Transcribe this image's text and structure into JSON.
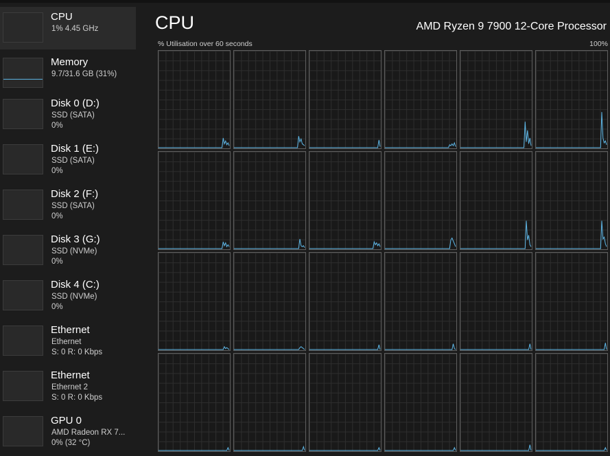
{
  "sidebar": {
    "items": [
      {
        "title": "CPU",
        "line1": "1%  4.45 GHz",
        "line2": ""
      },
      {
        "title": "Memory",
        "line1": "9.7/31.6 GB (31%)",
        "line2": ""
      },
      {
        "title": "Disk 0 (D:)",
        "line1": "SSD (SATA)",
        "line2": "0%"
      },
      {
        "title": "Disk 1 (E:)",
        "line1": "SSD (SATA)",
        "line2": "0%"
      },
      {
        "title": "Disk 2 (F:)",
        "line1": "SSD (SATA)",
        "line2": "0%"
      },
      {
        "title": "Disk 3 (G:)",
        "line1": "SSD (NVMe)",
        "line2": "0%"
      },
      {
        "title": "Disk 4 (C:)",
        "line1": "SSD (NVMe)",
        "line2": "0%"
      },
      {
        "title": "Ethernet",
        "line1": "Ethernet",
        "line2": "S: 0  R: 0 Kbps"
      },
      {
        "title": "Ethernet",
        "line1": "Ethernet 2",
        "line2": "S: 0  R: 0 Kbps"
      },
      {
        "title": "GPU 0",
        "line1": "AMD Radeon RX 7...",
        "line2": "0%  (32 °C)"
      }
    ],
    "memory_usage_fraction": 0.31
  },
  "main": {
    "title": "CPU",
    "processor": "AMD Ryzen 9 7900 12-Core Processor",
    "utilisation_label": "% Utilisation over 60 seconds",
    "max_label": "100%"
  },
  "colors": {
    "graph_line": "#5fb8e8",
    "background": "#1c1c1c",
    "selected": "#2b2b2b"
  },
  "cores": [
    [
      0,
      0,
      0,
      0,
      0,
      0,
      0,
      0,
      0,
      0,
      0,
      0,
      0,
      0,
      0,
      0,
      0,
      0,
      0,
      0,
      0,
      0,
      0,
      0,
      0,
      0,
      0,
      0,
      0,
      0,
      0,
      0,
      0,
      0,
      0,
      0,
      0,
      0,
      0,
      0,
      0,
      0,
      0,
      0,
      0,
      0,
      0,
      0,
      0,
      0,
      0,
      0,
      0,
      0,
      10,
      4,
      7,
      3,
      5,
      2
    ],
    [
      0,
      0,
      0,
      0,
      0,
      0,
      0,
      0,
      0,
      0,
      0,
      0,
      0,
      0,
      0,
      0,
      0,
      0,
      0,
      0,
      0,
      0,
      0,
      0,
      0,
      0,
      0,
      0,
      0,
      0,
      0,
      0,
      0,
      0,
      0,
      0,
      0,
      0,
      0,
      0,
      0,
      0,
      0,
      0,
      0,
      0,
      0,
      0,
      0,
      0,
      0,
      0,
      0,
      0,
      12,
      6,
      9,
      4,
      3,
      2
    ],
    [
      0,
      0,
      0,
      0,
      0,
      0,
      0,
      0,
      0,
      0,
      0,
      0,
      0,
      0,
      0,
      0,
      0,
      0,
      0,
      0,
      0,
      0,
      0,
      0,
      0,
      0,
      0,
      0,
      0,
      0,
      0,
      0,
      0,
      0,
      0,
      0,
      0,
      0,
      0,
      0,
      0,
      0,
      0,
      0,
      0,
      0,
      0,
      0,
      0,
      0,
      0,
      0,
      0,
      0,
      0,
      0,
      0,
      0,
      8,
      1
    ],
    [
      0,
      0,
      0,
      0,
      0,
      0,
      0,
      0,
      0,
      0,
      0,
      0,
      0,
      0,
      0,
      0,
      0,
      0,
      0,
      0,
      0,
      0,
      0,
      0,
      0,
      0,
      0,
      0,
      0,
      0,
      0,
      0,
      0,
      0,
      0,
      0,
      0,
      0,
      0,
      0,
      0,
      0,
      0,
      0,
      0,
      0,
      0,
      0,
      0,
      0,
      0,
      0,
      0,
      0,
      3,
      2,
      4,
      2,
      5,
      1
    ],
    [
      0,
      0,
      0,
      0,
      0,
      0,
      0,
      0,
      0,
      0,
      0,
      0,
      0,
      0,
      0,
      0,
      0,
      0,
      0,
      0,
      0,
      0,
      0,
      0,
      0,
      0,
      0,
      0,
      0,
      0,
      0,
      0,
      0,
      0,
      0,
      0,
      0,
      0,
      0,
      0,
      0,
      0,
      0,
      0,
      0,
      0,
      0,
      0,
      0,
      0,
      0,
      0,
      0,
      0,
      27,
      6,
      18,
      4,
      10,
      2
    ],
    [
      0,
      0,
      0,
      0,
      0,
      0,
      0,
      0,
      0,
      0,
      0,
      0,
      0,
      0,
      0,
      0,
      0,
      0,
      0,
      0,
      0,
      0,
      0,
      0,
      0,
      0,
      0,
      0,
      0,
      0,
      0,
      0,
      0,
      0,
      0,
      0,
      0,
      0,
      0,
      0,
      0,
      0,
      0,
      0,
      0,
      0,
      0,
      0,
      0,
      0,
      0,
      0,
      0,
      0,
      0,
      37,
      10,
      5,
      7,
      3
    ],
    [
      0,
      0,
      0,
      0,
      0,
      0,
      0,
      0,
      0,
      0,
      0,
      0,
      0,
      0,
      0,
      0,
      0,
      0,
      0,
      0,
      0,
      0,
      0,
      0,
      0,
      0,
      0,
      0,
      0,
      0,
      0,
      0,
      0,
      0,
      0,
      0,
      0,
      0,
      0,
      0,
      0,
      0,
      0,
      0,
      0,
      0,
      0,
      0,
      0,
      0,
      0,
      0,
      0,
      0,
      7,
      3,
      6,
      2,
      4,
      2
    ],
    [
      0,
      0,
      0,
      0,
      0,
      0,
      0,
      0,
      0,
      0,
      0,
      0,
      0,
      0,
      0,
      0,
      0,
      0,
      0,
      0,
      0,
      0,
      0,
      0,
      0,
      0,
      0,
      0,
      0,
      0,
      0,
      0,
      0,
      0,
      0,
      0,
      0,
      0,
      0,
      0,
      0,
      0,
      0,
      0,
      0,
      0,
      0,
      0,
      0,
      0,
      0,
      0,
      0,
      0,
      0,
      10,
      3,
      2,
      3,
      1
    ],
    [
      0,
      0,
      0,
      0,
      0,
      0,
      0,
      0,
      0,
      0,
      0,
      0,
      0,
      0,
      0,
      0,
      0,
      0,
      0,
      0,
      0,
      0,
      0,
      0,
      0,
      0,
      0,
      0,
      0,
      0,
      0,
      0,
      0,
      0,
      0,
      0,
      0,
      0,
      0,
      0,
      0,
      0,
      0,
      0,
      0,
      0,
      0,
      0,
      0,
      0,
      0,
      0,
      0,
      0,
      7,
      4,
      6,
      3,
      5,
      2
    ],
    [
      0,
      0,
      0,
      0,
      0,
      0,
      0,
      0,
      0,
      0,
      0,
      0,
      0,
      0,
      0,
      0,
      0,
      0,
      0,
      0,
      0,
      0,
      0,
      0,
      0,
      0,
      0,
      0,
      0,
      0,
      0,
      0,
      0,
      0,
      0,
      0,
      0,
      0,
      0,
      0,
      0,
      0,
      0,
      0,
      0,
      0,
      0,
      0,
      0,
      0,
      0,
      0,
      0,
      0,
      0,
      9,
      11,
      8,
      5,
      2
    ],
    [
      0,
      0,
      0,
      0,
      0,
      0,
      0,
      0,
      0,
      0,
      0,
      0,
      0,
      0,
      0,
      0,
      0,
      0,
      0,
      0,
      0,
      0,
      0,
      0,
      0,
      0,
      0,
      0,
      0,
      0,
      0,
      0,
      0,
      0,
      0,
      0,
      0,
      0,
      0,
      0,
      0,
      0,
      0,
      0,
      0,
      0,
      0,
      0,
      0,
      0,
      0,
      0,
      0,
      0,
      0,
      29,
      9,
      14,
      4,
      2
    ],
    [
      0,
      0,
      0,
      0,
      0,
      0,
      0,
      0,
      0,
      0,
      0,
      0,
      0,
      0,
      0,
      0,
      0,
      0,
      0,
      0,
      0,
      0,
      0,
      0,
      0,
      0,
      0,
      0,
      0,
      0,
      0,
      0,
      0,
      0,
      0,
      0,
      0,
      0,
      0,
      0,
      0,
      0,
      0,
      0,
      0,
      0,
      0,
      0,
      0,
      0,
      0,
      0,
      0,
      0,
      0,
      29,
      10,
      12,
      5,
      2
    ],
    [
      0,
      0,
      0,
      0,
      0,
      0,
      0,
      0,
      0,
      0,
      0,
      0,
      0,
      0,
      0,
      0,
      0,
      0,
      0,
      0,
      0,
      0,
      0,
      0,
      0,
      0,
      0,
      0,
      0,
      0,
      0,
      0,
      0,
      0,
      0,
      0,
      0,
      0,
      0,
      0,
      0,
      0,
      0,
      0,
      0,
      0,
      0,
      0,
      0,
      0,
      0,
      0,
      0,
      0,
      0,
      3,
      1,
      2,
      1,
      0
    ],
    [
      0,
      0,
      0,
      0,
      0,
      0,
      0,
      0,
      0,
      0,
      0,
      0,
      0,
      0,
      0,
      0,
      0,
      0,
      0,
      0,
      0,
      0,
      0,
      0,
      0,
      0,
      0,
      0,
      0,
      0,
      0,
      0,
      0,
      0,
      0,
      0,
      0,
      0,
      0,
      0,
      0,
      0,
      0,
      0,
      0,
      0,
      0,
      0,
      0,
      0,
      0,
      0,
      0,
      0,
      0,
      2,
      3,
      2,
      1,
      0
    ],
    [
      0,
      0,
      0,
      0,
      0,
      0,
      0,
      0,
      0,
      0,
      0,
      0,
      0,
      0,
      0,
      0,
      0,
      0,
      0,
      0,
      0,
      0,
      0,
      0,
      0,
      0,
      0,
      0,
      0,
      0,
      0,
      0,
      0,
      0,
      0,
      0,
      0,
      0,
      0,
      0,
      0,
      0,
      0,
      0,
      0,
      0,
      0,
      0,
      0,
      0,
      0,
      0,
      0,
      0,
      0,
      0,
      0,
      0,
      5,
      0
    ],
    [
      0,
      0,
      0,
      0,
      0,
      0,
      0,
      0,
      0,
      0,
      0,
      0,
      0,
      0,
      0,
      0,
      0,
      0,
      0,
      0,
      0,
      0,
      0,
      0,
      0,
      0,
      0,
      0,
      0,
      0,
      0,
      0,
      0,
      0,
      0,
      0,
      0,
      0,
      0,
      0,
      0,
      0,
      0,
      0,
      0,
      0,
      0,
      0,
      0,
      0,
      0,
      0,
      0,
      0,
      0,
      0,
      0,
      6,
      1,
      0
    ],
    [
      0,
      0,
      0,
      0,
      0,
      0,
      0,
      0,
      0,
      0,
      0,
      0,
      0,
      0,
      0,
      0,
      0,
      0,
      0,
      0,
      0,
      0,
      0,
      0,
      0,
      0,
      0,
      0,
      0,
      0,
      0,
      0,
      0,
      0,
      0,
      0,
      0,
      0,
      0,
      0,
      0,
      0,
      0,
      0,
      0,
      0,
      0,
      0,
      0,
      0,
      0,
      0,
      0,
      0,
      0,
      0,
      0,
      0,
      6,
      0
    ],
    [
      0,
      0,
      0,
      0,
      0,
      0,
      0,
      0,
      0,
      0,
      0,
      0,
      0,
      0,
      0,
      0,
      0,
      0,
      0,
      0,
      0,
      0,
      0,
      0,
      0,
      0,
      0,
      0,
      0,
      0,
      0,
      0,
      0,
      0,
      0,
      0,
      0,
      0,
      0,
      0,
      0,
      0,
      0,
      0,
      0,
      0,
      0,
      0,
      0,
      0,
      0,
      0,
      0,
      0,
      0,
      0,
      0,
      0,
      7,
      0
    ],
    [
      0,
      0,
      0,
      0,
      0,
      0,
      0,
      0,
      0,
      0,
      0,
      0,
      0,
      0,
      0,
      0,
      0,
      0,
      0,
      0,
      0,
      0,
      0,
      0,
      0,
      0,
      0,
      0,
      0,
      0,
      0,
      0,
      0,
      0,
      0,
      0,
      0,
      0,
      0,
      0,
      0,
      0,
      0,
      0,
      0,
      0,
      0,
      0,
      0,
      0,
      0,
      0,
      0,
      0,
      0,
      0,
      0,
      0,
      3,
      0
    ],
    [
      0,
      0,
      0,
      0,
      0,
      0,
      0,
      0,
      0,
      0,
      0,
      0,
      0,
      0,
      0,
      0,
      0,
      0,
      0,
      0,
      0,
      0,
      0,
      0,
      0,
      0,
      0,
      0,
      0,
      0,
      0,
      0,
      0,
      0,
      0,
      0,
      0,
      0,
      0,
      0,
      0,
      0,
      0,
      0,
      0,
      0,
      0,
      0,
      0,
      0,
      0,
      0,
      0,
      0,
      0,
      0,
      0,
      0,
      4,
      0
    ],
    [
      0,
      0,
      0,
      0,
      0,
      0,
      0,
      0,
      0,
      0,
      0,
      0,
      0,
      0,
      0,
      0,
      0,
      0,
      0,
      0,
      0,
      0,
      0,
      0,
      0,
      0,
      0,
      0,
      0,
      0,
      0,
      0,
      0,
      0,
      0,
      0,
      0,
      0,
      0,
      0,
      0,
      0,
      0,
      0,
      0,
      0,
      0,
      0,
      0,
      0,
      0,
      0,
      0,
      0,
      0,
      0,
      0,
      0,
      3,
      0
    ],
    [
      0,
      0,
      0,
      0,
      0,
      0,
      0,
      0,
      0,
      0,
      0,
      0,
      0,
      0,
      0,
      0,
      0,
      0,
      0,
      0,
      0,
      0,
      0,
      0,
      0,
      0,
      0,
      0,
      0,
      0,
      0,
      0,
      0,
      0,
      0,
      0,
      0,
      0,
      0,
      0,
      0,
      0,
      0,
      0,
      0,
      0,
      0,
      0,
      0,
      0,
      0,
      0,
      0,
      0,
      0,
      0,
      0,
      0,
      3,
      0
    ],
    [
      0,
      0,
      0,
      0,
      0,
      0,
      0,
      0,
      0,
      0,
      0,
      0,
      0,
      0,
      0,
      0,
      0,
      0,
      0,
      0,
      0,
      0,
      0,
      0,
      0,
      0,
      0,
      0,
      0,
      0,
      0,
      0,
      0,
      0,
      0,
      0,
      0,
      0,
      0,
      0,
      0,
      0,
      0,
      0,
      0,
      0,
      0,
      0,
      0,
      0,
      0,
      0,
      0,
      0,
      0,
      0,
      0,
      0,
      6,
      0
    ],
    [
      0,
      0,
      0,
      0,
      0,
      0,
      0,
      0,
      0,
      0,
      0,
      0,
      0,
      0,
      0,
      0,
      0,
      0,
      0,
      0,
      0,
      0,
      0,
      0,
      0,
      0,
      0,
      0,
      0,
      0,
      0,
      0,
      0,
      0,
      0,
      0,
      0,
      0,
      0,
      0,
      0,
      0,
      0,
      0,
      0,
      0,
      0,
      0,
      0,
      0,
      0,
      0,
      0,
      0,
      0,
      0,
      0,
      0,
      3,
      0
    ]
  ]
}
